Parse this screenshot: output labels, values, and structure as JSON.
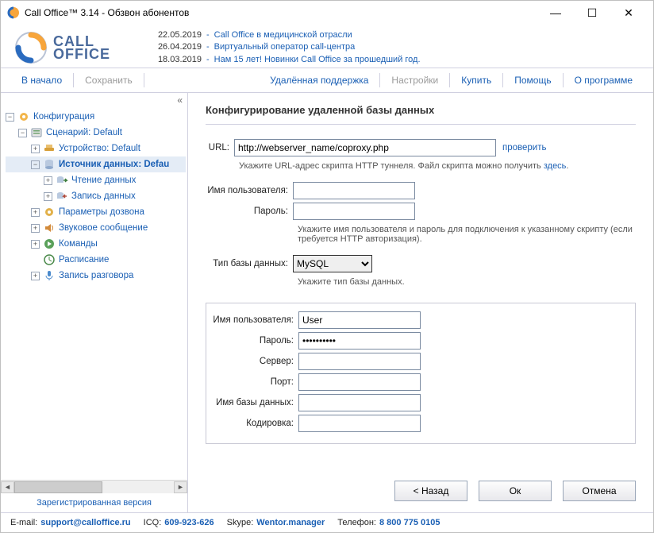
{
  "window": {
    "title": "Call Office™ 3.14 - Обзвон абонентов"
  },
  "logo": {
    "line1": "CALL",
    "line2": "OFFICE"
  },
  "news": [
    {
      "date": "22.05.2019",
      "title": "Call Office в медицинской отрасли"
    },
    {
      "date": "26.04.2019",
      "title": "Виртуальный оператор call-центра"
    },
    {
      "date": "18.03.2019",
      "title": "Нам 15 лет! Новинки Call Office за прошедший год."
    }
  ],
  "menu": {
    "start": "В начало",
    "save": "Сохранить",
    "remote": "Удалённая поддержка",
    "settings": "Настройки",
    "buy": "Купить",
    "help": "Помощь",
    "about": "О программе"
  },
  "tree": {
    "config": "Конфигурация",
    "scenario": "Сценарий: Default",
    "device": "Устройство: Default",
    "datasource": "Источник данных: Defau",
    "read": "Чтение данных",
    "write": "Запись данных",
    "dialparams": "Параметры дозвона",
    "audio": "Звуковое сообщение",
    "commands": "Команды",
    "schedule": "Расписание",
    "record": "Запись разговора"
  },
  "sidebar_footer": "Зарегистрированная версия",
  "page": {
    "title": "Конфигурирование удаленной базы данных",
    "url_label": "URL:",
    "url_value": "http://webserver_name/coproxy.php",
    "check": "проверить",
    "url_hint_a": "Укажите URL-адрес скрипта HTTP туннеля. Файл скрипта можно получить ",
    "url_hint_link": "здесь",
    "user_label": "Имя пользователя:",
    "pass_label": "Пароль:",
    "auth_hint": "Укажите имя пользователя и пароль для подключения к указанному скрипту (если требуется HTTP авторизация).",
    "dbtype_label": "Тип базы данных:",
    "dbtype_value": "MySQL",
    "dbtype_hint": "Укажите тип базы данных.",
    "db_user_label": "Имя пользователя:",
    "db_user_value": "User",
    "db_pass_label": "Пароль:",
    "db_pass_value": "••••••••••",
    "db_server_label": "Сервер:",
    "db_port_label": "Порт:",
    "db_name_label": "Имя базы данных:",
    "db_encoding_label": "Кодировка:"
  },
  "buttons": {
    "back": "< Назад",
    "ok": "Ок",
    "cancel": "Отмена"
  },
  "status": {
    "email_l": "E-mail:",
    "email_v": "support@calloffice.ru",
    "icq_l": "ICQ:",
    "icq_v": "609-923-626",
    "skype_l": "Skype:",
    "skype_v": "Wentor.manager",
    "tel_l": "Телефон:",
    "tel_v": "8 800 775 0105"
  }
}
